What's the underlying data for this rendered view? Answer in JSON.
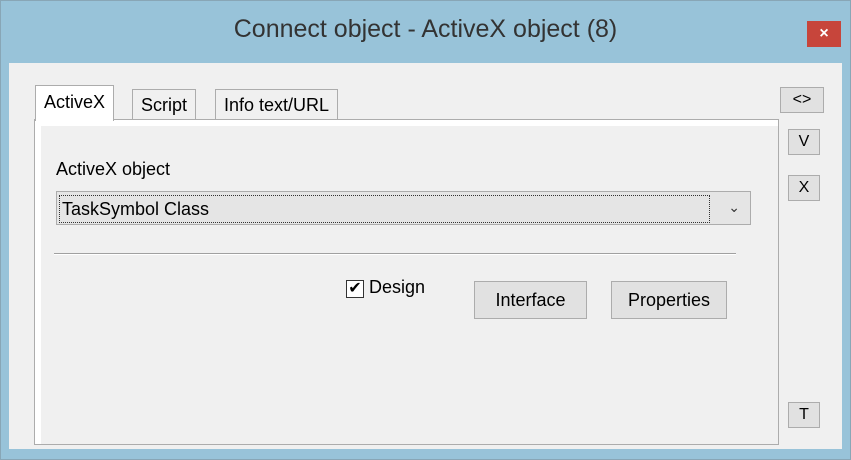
{
  "window": {
    "title": "Connect object - ActiveX object (8)",
    "close_glyph": "×"
  },
  "tabs": [
    {
      "label": "ActiveX",
      "active": true
    },
    {
      "label": "Script",
      "active": false
    },
    {
      "label": "Info text/URL",
      "active": false
    }
  ],
  "form": {
    "activex_label": "ActiveX object",
    "activex_value": "TaskSymbol Class",
    "dropdown_glyph": "⌄",
    "design_checkbox": {
      "label": "Design",
      "checked": true,
      "check_glyph": "✔"
    },
    "interface_button": "Interface",
    "properties_button": "Properties"
  },
  "side_buttons": {
    "expand": "<>",
    "ok": "V",
    "cancel": "X",
    "t": "T"
  }
}
